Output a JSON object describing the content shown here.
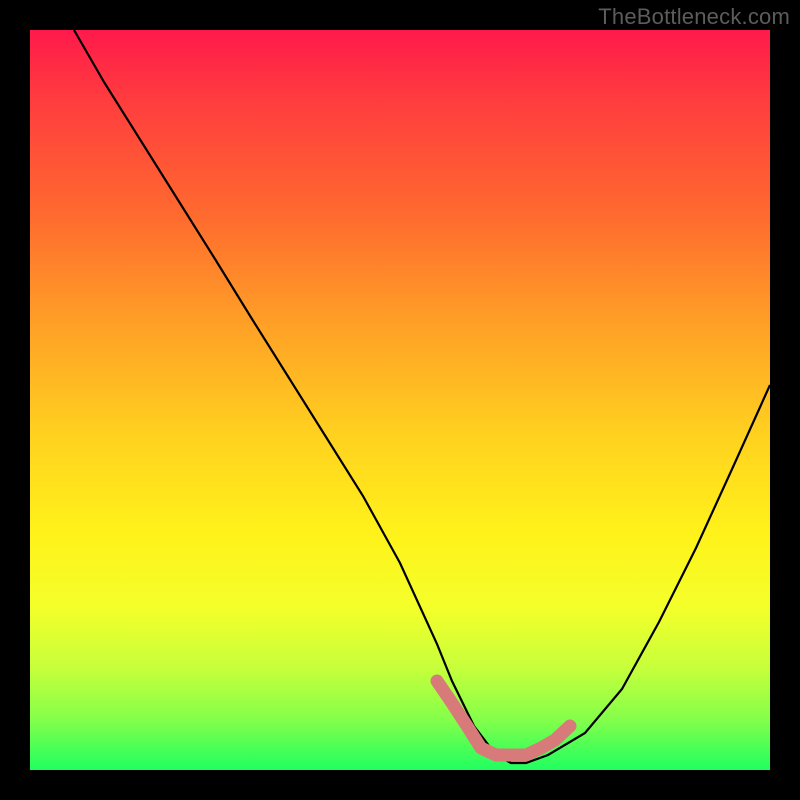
{
  "watermark": "TheBottleneck.com",
  "chart_data": {
    "type": "line",
    "title": "",
    "xlabel": "",
    "ylabel": "",
    "ylim": [
      0,
      100
    ],
    "xlim": [
      0,
      100
    ],
    "series": [
      {
        "name": "bottleneck-curve",
        "x": [
          6,
          10,
          15,
          20,
          25,
          30,
          35,
          40,
          45,
          50,
          55,
          57,
          60,
          63,
          65,
          67,
          70,
          75,
          80,
          85,
          90,
          95,
          100
        ],
        "values": [
          100,
          93,
          85,
          77,
          69,
          61,
          53,
          45,
          37,
          28,
          17,
          12,
          6,
          2,
          1,
          1,
          2,
          5,
          11,
          20,
          30,
          41,
          52
        ]
      },
      {
        "name": "sweet-spot-marker",
        "x": [
          55,
          57,
          59,
          61,
          63,
          65,
          67,
          69,
          71,
          73
        ],
        "values": [
          12,
          9,
          6,
          3,
          2,
          2,
          2,
          3,
          4,
          6
        ]
      }
    ],
    "colors": {
      "curve": "#000000",
      "marker": "#d87a7a",
      "gradient_top": "#ff1a4b",
      "gradient_bottom": "#20ff60"
    }
  }
}
